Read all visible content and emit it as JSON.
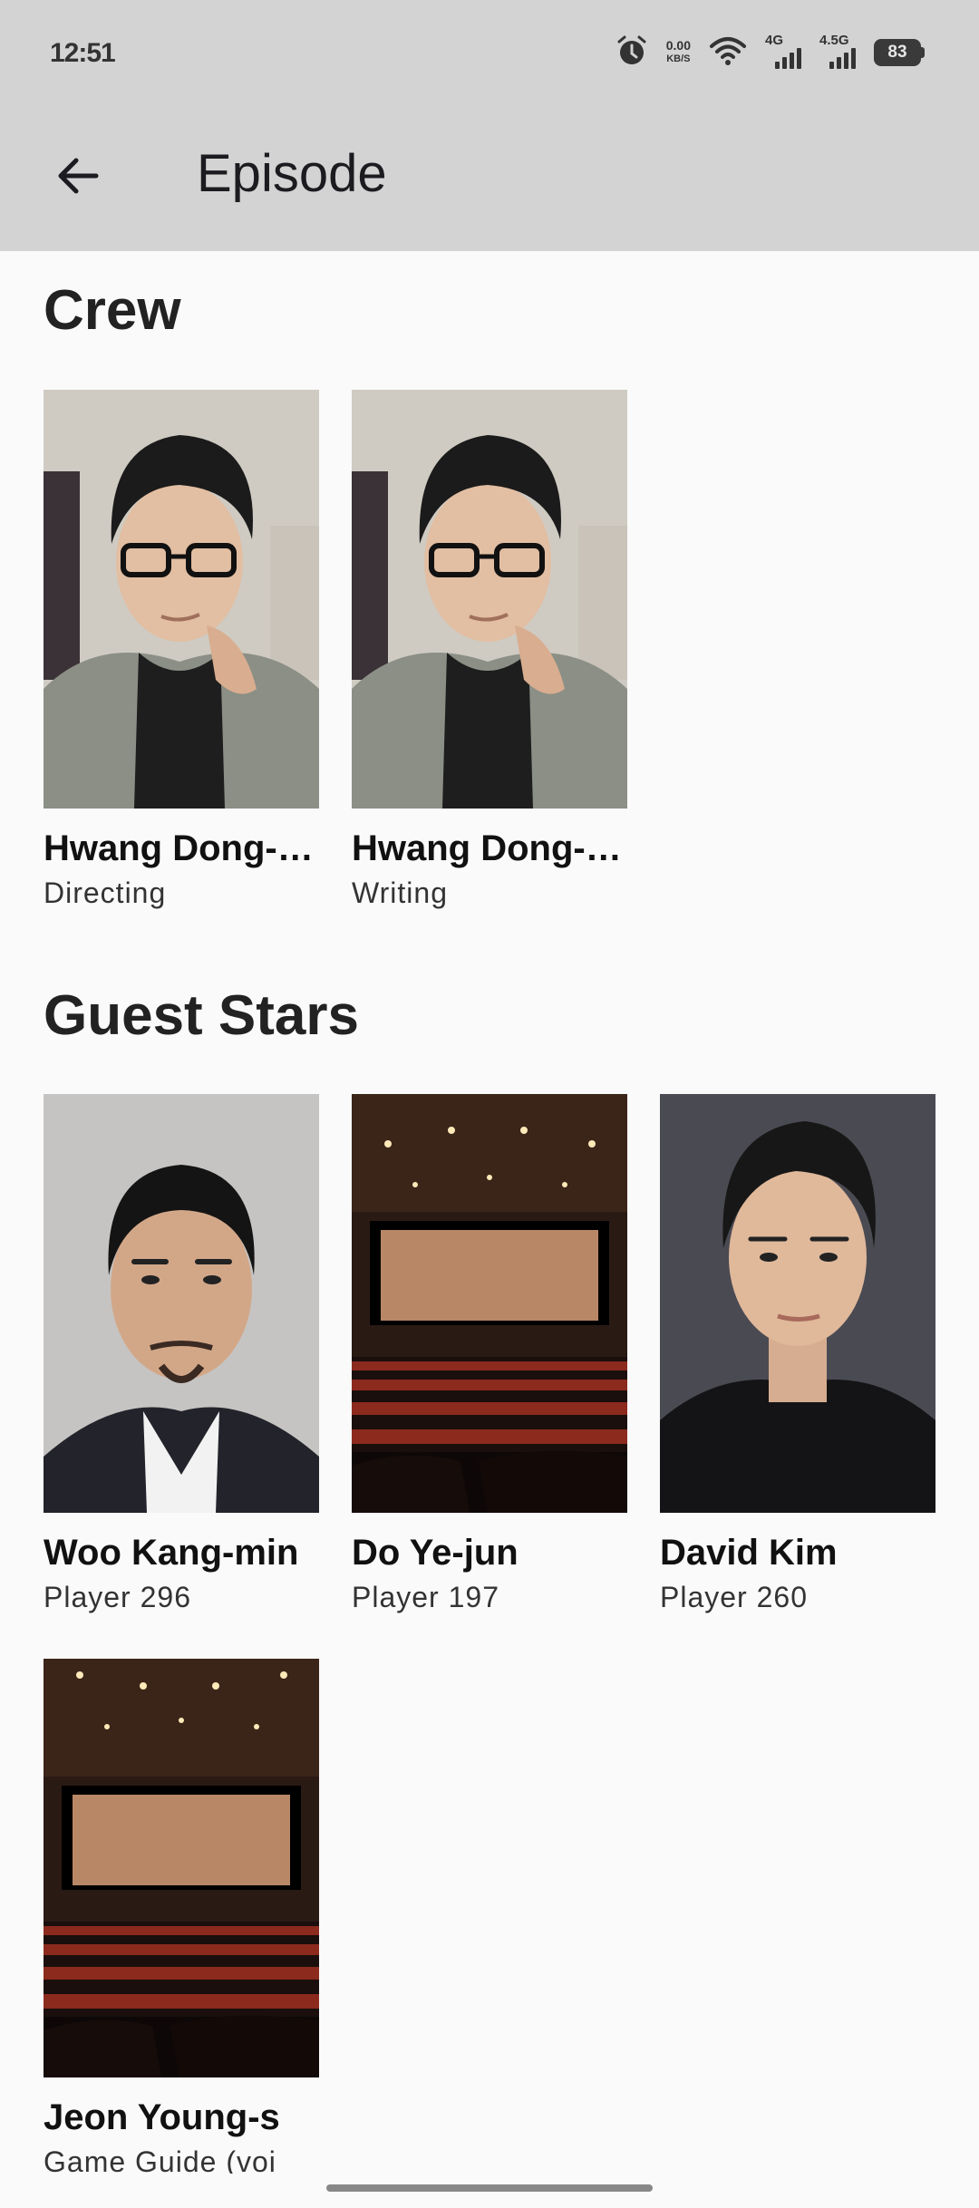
{
  "status_bar": {
    "time": "12:51",
    "net_speed_value": "0.00",
    "net_speed_unit": "KB/S",
    "signal1_label": "4G",
    "signal2_label": "4.5G",
    "battery": "83",
    "icons": [
      "alarm-icon",
      "wifi-icon",
      "signal-icon",
      "battery-icon"
    ]
  },
  "app_bar": {
    "title": "Episode",
    "back_icon": "arrow-left-icon"
  },
  "crew": {
    "title": "Crew",
    "members": [
      {
        "name": "Hwang Dong-hyuk",
        "role": "Directing",
        "photo": "portrait"
      },
      {
        "name": "Hwang Dong-hyuk",
        "role": "Writing",
        "photo": "portrait"
      }
    ]
  },
  "guest_stars": {
    "title": "Guest Stars",
    "members": [
      {
        "name": "Woo Kang-min",
        "role": "Player 296",
        "photo": "portrait"
      },
      {
        "name": "Do Ye-jun",
        "role": "Player 197",
        "photo": "placeholder-theater"
      },
      {
        "name": "David Kim",
        "role": "Player 260",
        "photo": "portrait"
      },
      {
        "name": "Jeon Young-s",
        "role": "Game Guide (voi",
        "photo": "placeholder-theater"
      }
    ]
  },
  "colors": {
    "app_bar_bg": "#d3d3d3",
    "page_bg": "#fafafa"
  }
}
